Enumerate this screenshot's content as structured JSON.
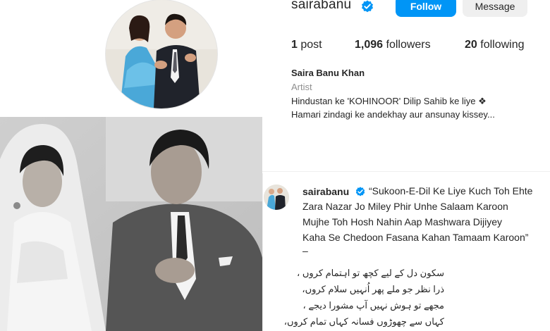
{
  "profile": {
    "username": "sairabanu",
    "follow_label": "Follow",
    "message_label": "Message",
    "posts_count": "1",
    "posts_label": "post",
    "followers_count": "1,096",
    "followers_label": "followers",
    "following_count": "20",
    "following_label": "following",
    "display_name": "Saira Banu Khan",
    "category": "Artist",
    "bio_line1": "Hindustan ke 'KOHINOOR' Dilip Sahib ke liye ❖",
    "bio_line2": "Hamari zindagi ke andekhay aur ansunay kissey..."
  },
  "post": {
    "username": "sairabanu",
    "caption_line1": "“Sukoon-E-Dil Ke Liye Kuch Toh Ehte",
    "caption_line2": "Zara Nazar Jo Miley Phir Unhe Salaam Karoon",
    "caption_line3": "Mujhe Toh Hosh Nahin Aap Mashwara Dijiyey",
    "caption_line4": "Kaha Se Chedoon Fasana Kahan Tamaam Karoon”",
    "caption_dash": "–",
    "urdu_line1": "سکون دل کے لیے کچھ تو اہتمام کروں ،",
    "urdu_line2": "ذرا نظر جو ملے پھر اُنہیں سلام کروں،",
    "urdu_line3": "مجھے تو ہوش نہیں آپ مشورا دیجے ،",
    "urdu_line4": "کہاں سے چھوڑوں فسانہ کہاں تمام کروں،"
  },
  "colors": {
    "follow_blue": "#0095f6",
    "verified_blue": "#0095f6",
    "muted_text": "#8e8e8e"
  },
  "icons": {
    "verified": "verified-badge-icon"
  }
}
